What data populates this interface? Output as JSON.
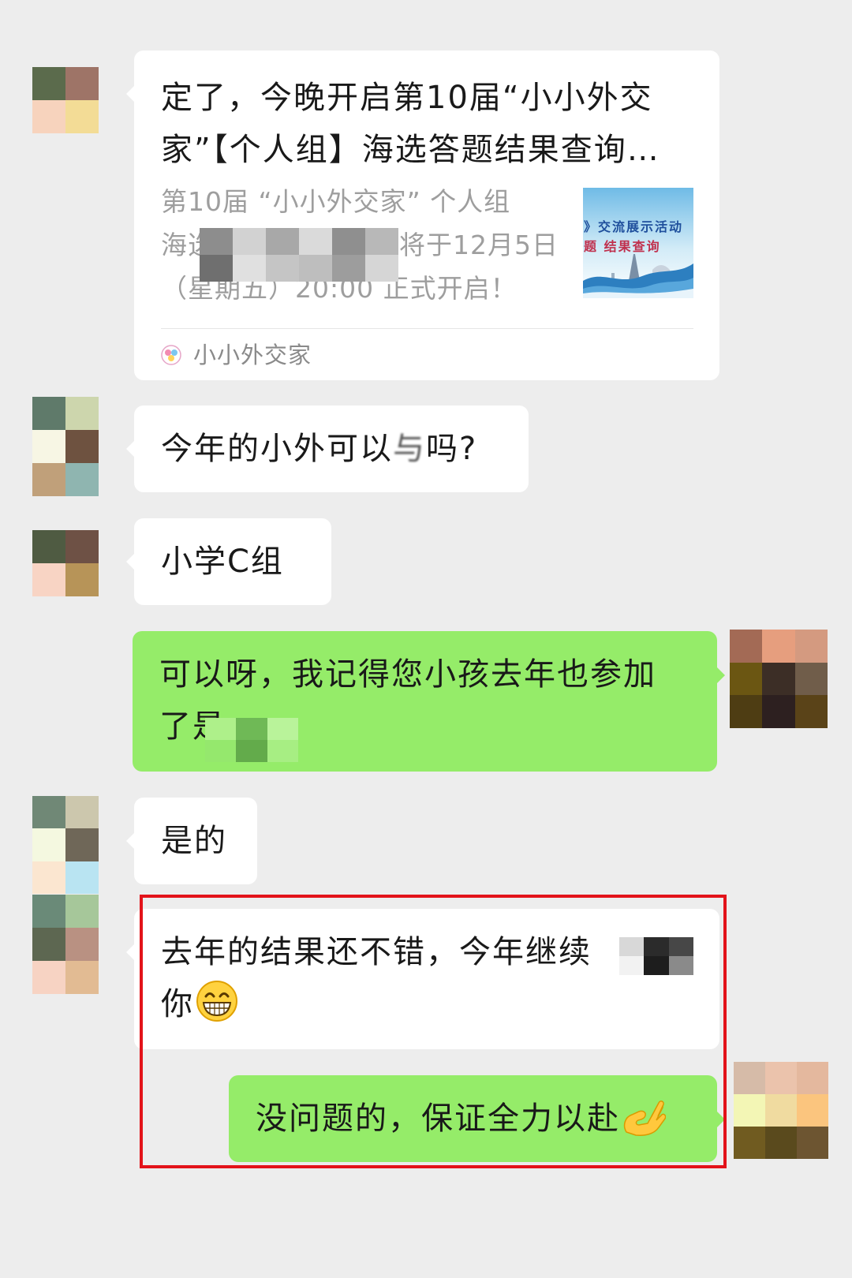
{
  "colors": {
    "background": "#ededed",
    "incoming_bubble": "#ffffff",
    "outgoing_bubble": "#95ec69",
    "highlight_frame": "#e3131a"
  },
  "chat": {
    "article": {
      "title_lines": [
        "定了，今晚开启第10届“小小外交",
        "家”【个人组】海选答题结果查询…"
      ],
      "description": {
        "line1": "第10届 “小小外交家” 个人组",
        "line2_start": "海选",
        "line2_end": "将于12月5日",
        "line3": "（星期五）20:00 正式开启！"
      },
      "thumbnail": {
        "line1": "》交流展示活动",
        "line2": "题 结果查询"
      },
      "source": {
        "name": "小小外交家",
        "icon": "source-logo-icon"
      }
    },
    "messages": [
      {
        "direction": "incoming",
        "text_before": "今年的小外可以",
        "text_obscured": "与",
        "text_after": "吗?"
      },
      {
        "direction": "incoming",
        "text": "小学C组"
      },
      {
        "direction": "outgoing",
        "lines": [
          "可以呀，我记得您小孩去年也参加",
          "了是"
        ]
      },
      {
        "direction": "incoming",
        "text": "是的"
      },
      {
        "direction": "incoming",
        "line1": "去年的结果还不错，今年继续",
        "line2": "你",
        "emoji": "grinning-face-emoji"
      },
      {
        "direction": "outgoing",
        "text": "没问题的，保证全力以赴",
        "emoji": "ok-hand-emoji"
      }
    ]
  },
  "avatars": {
    "article_sender": [
      [
        "#5b6b4c",
        "#9e7467"
      ],
      [
        "#f7d3bd",
        "#f3dc96"
      ]
    ],
    "question_sender": [
      [
        "#5f7a6a",
        "#cdd6ad"
      ],
      [
        "#f7f6e4",
        "#6e5240"
      ],
      [
        "#c0a07a",
        "#8fb5b0"
      ]
    ],
    "grade_sender": [
      [
        "#4f5b42",
        "#6e5145"
      ],
      [
        "#f8d4c4",
        "#b79458"
      ]
    ],
    "self_a": [
      [
        "#a36a55",
        "#e69e7e",
        "#d49a80"
      ],
      [
        "#6b5612",
        "#3c2e26",
        "#705d4a"
      ],
      [
        "#4e3d13",
        "#2d2020",
        "#5a4318"
      ]
    ],
    "yes_sender": [
      [
        "#708876",
        "#ccc7ad"
      ],
      [
        "#f4f8e0",
        "#6f6758"
      ],
      [
        "#fbe6d0",
        "#b9e4f2"
      ]
    ],
    "praise_sender": [
      [
        "#6a8a78",
        "#a6c79a"
      ],
      [
        "#5d6751",
        "#b99182"
      ],
      [
        "#f7d3c3",
        "#e2bb93"
      ]
    ],
    "self_b": [
      [
        "#d6bba8",
        "#ebc3ac",
        "#e4b89e"
      ],
      [
        "#f3f6b5",
        "#f0dba0",
        "#fbc57e"
      ],
      [
        "#705b20",
        "#5a4a1d",
        "#6d5531"
      ]
    ]
  },
  "redactions": {
    "article_desc": [
      [
        "#8d8d8d",
        "#d2d2d2",
        "#a8a8a8",
        "#dadada",
        "#8f8f8f",
        "#b8b8b8"
      ],
      [
        "#6f6f6f",
        "#e0e0e0",
        "#c5c5c5",
        "#bebebe",
        "#9d9d9d",
        "#d6d6d6"
      ]
    ],
    "reply_line2": [
      [
        "#aef08a",
        "#6fb956",
        "#b9f39a"
      ],
      [
        "#95e86d",
        "#63ab4b",
        "#a7ee83"
      ]
    ],
    "praise_line1": [
      [
        "#d8d8d8",
        "#2b2b2b",
        "#474747"
      ],
      [
        "#f2f2f2",
        "#1d1d1d",
        "#8a8a8a"
      ]
    ]
  }
}
